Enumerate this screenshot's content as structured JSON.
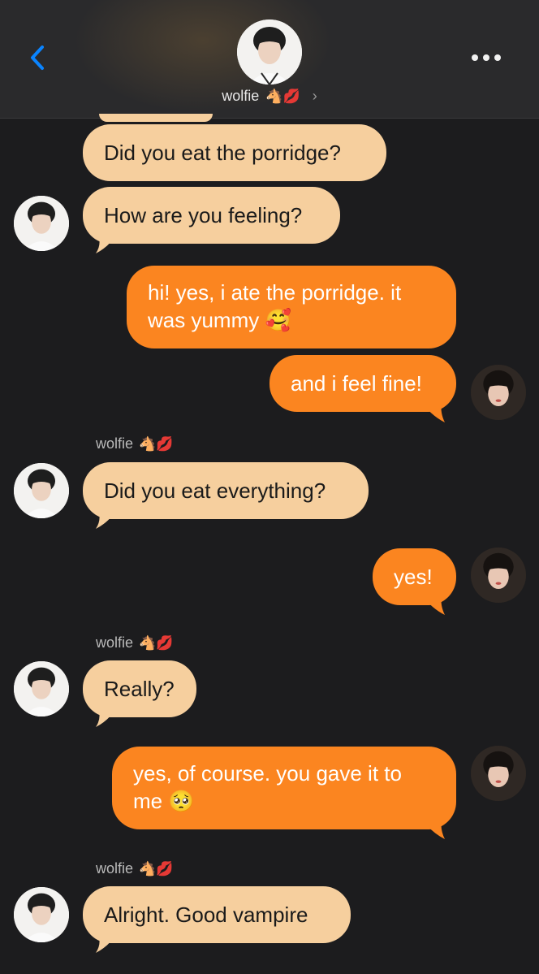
{
  "header": {
    "contact_name": "wolfie",
    "name_emoji": "🐴💋",
    "chevron": "›",
    "back_icon": "chevron-left-icon",
    "more_icon": "ellipsis-icon"
  },
  "colors": {
    "incoming_bubble": "#f6cf9e",
    "outgoing_bubble": "#fb8520",
    "background": "#1c1c1e",
    "back_accent": "#0a84ff"
  },
  "messages": [
    {
      "from": "wolfie",
      "text": "Did you eat the porridge?"
    },
    {
      "from": "wolfie",
      "text": "How are you feeling?"
    },
    {
      "from": "me",
      "text": "hi! yes, i ate the porridge. it was yummy 🥰"
    },
    {
      "from": "me",
      "text": "and i feel fine!"
    },
    {
      "from": "wolfie",
      "sender_label": "wolfie",
      "sender_emoji": "🐴💋",
      "text": "Did you eat everything?"
    },
    {
      "from": "me",
      "text": "yes!"
    },
    {
      "from": "wolfie",
      "sender_label": "wolfie",
      "sender_emoji": "🐴💋",
      "text": "Really?"
    },
    {
      "from": "me",
      "text": "yes, of course. you gave it to me 🥺"
    },
    {
      "from": "wolfie",
      "sender_label": "wolfie",
      "sender_emoji": "🐴💋",
      "text": "Alright. Good vampire"
    }
  ]
}
